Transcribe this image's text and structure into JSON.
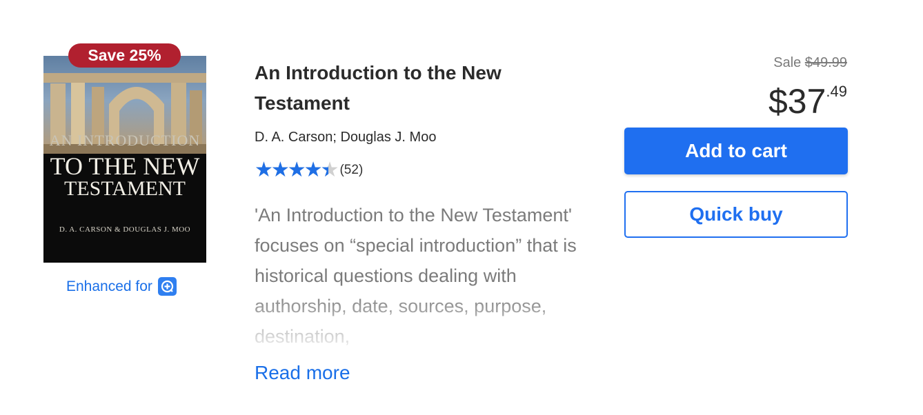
{
  "badge": {
    "text": "Save 25%"
  },
  "cover": {
    "line1": "AN INTRODUCTION",
    "line2": "TO THE NEW",
    "line3": "TESTAMENT",
    "authors": "D. A. CARSON & DOUGLAS J. MOO"
  },
  "enhanced": {
    "label": "Enhanced for",
    "icon": "logos-icon"
  },
  "product": {
    "title": "An Introduction to the New Testament",
    "author": "D. A. Carson; Douglas J. Moo",
    "rating_value": 4.5,
    "rating_max": 5,
    "rating_count": "(52)",
    "description": "'An Introduction to the New Testament' focuses on “special introduction” that is historical questions dealing with authorship, date, sources, purpose, destination,",
    "read_more": "Read more"
  },
  "pricing": {
    "sale_label": "Sale",
    "original_price": "$49.99",
    "price_main": "$37",
    "price_cents": ".49"
  },
  "actions": {
    "add_to_cart": "Add to cart",
    "quick_buy": "Quick buy"
  },
  "colors": {
    "accent": "#1f6ff0",
    "badge": "#b1202f",
    "star": "#1f6fe5"
  }
}
